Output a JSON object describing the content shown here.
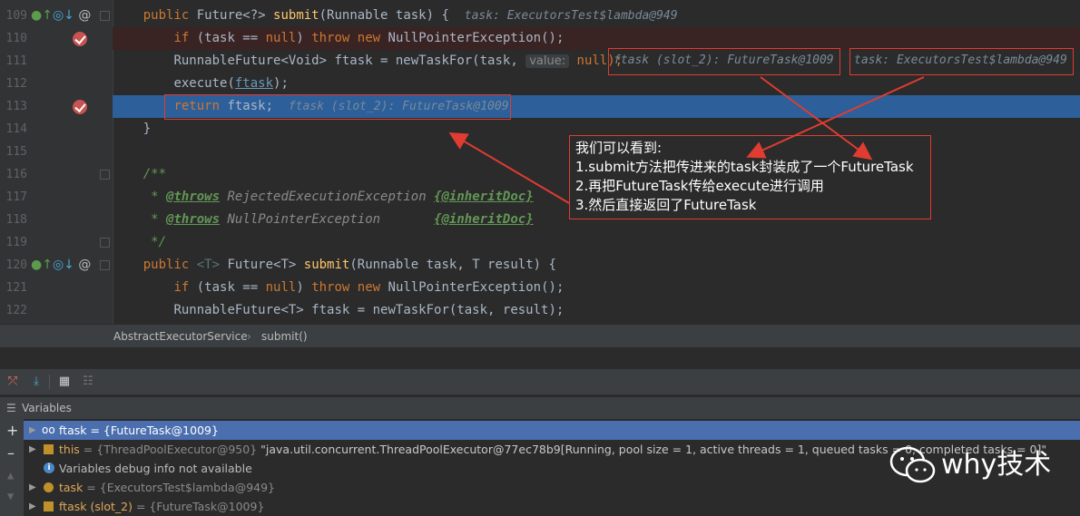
{
  "editor": {
    "lines": [
      {
        "num": "109"
      },
      {
        "num": "110"
      },
      {
        "num": "111"
      },
      {
        "num": "112"
      },
      {
        "num": "113"
      },
      {
        "num": "114"
      },
      {
        "num": "115"
      },
      {
        "num": "116"
      },
      {
        "num": "117"
      },
      {
        "num": "118"
      },
      {
        "num": "119"
      },
      {
        "num": "120"
      },
      {
        "num": "121"
      },
      {
        "num": "122"
      }
    ],
    "tokens": {
      "public": "public",
      "future_gen": "Future<?>",
      "submit": "submit",
      "runnable_task": "(Runnable task) {",
      "hint_task": "task: ExecutorsTest$lambda@949",
      "if": "if",
      "task_null": "(task == ",
      "null": "null",
      "close_paren": ")",
      "throw": "throw",
      "new": "new",
      "npe": "NullPointerException();",
      "runnable_future": "RunnableFuture<Void>",
      "ftask_assign": "ftask = newTaskFor(task,",
      "value_label": "value:",
      "null_close": "null);",
      "hint_ftask_slot": "ftask (slot_2): FutureTask@1009",
      "hint_task_lambda": "task: ExecutorsTest$lambda@949",
      "execute_open": "execute(",
      "ftask": "ftask",
      "close_semi": ");",
      "return": "return",
      "ftask_semi": "ftask;",
      "hint_ftask_slot2": "ftask (slot_2): FutureTask@1009",
      "close_brace": "}",
      "javadoc_open": "/**",
      "star": "*",
      "throws": "@throws",
      "rejected": "RejectedExecutionException",
      "inherit": "{@inheritDoc}",
      "npe_doc": "NullPointerException",
      "javadoc_close": "*/",
      "t_gen": "<T>",
      "future_t": "Future<T>",
      "runnable_task_result": "(Runnable task, T result) {",
      "runnable_future_t": "RunnableFuture<T>",
      "ftask_assign_result": "ftask = newTaskFor(task, result);"
    }
  },
  "note": {
    "lines": [
      "我们可以看到:",
      "1.submit方法把传进来的task封装成了一个FutureTask",
      "2.再把FutureTask传给execute进行调用",
      "3.然后直接返回了FutureTask"
    ]
  },
  "breadcrumb": {
    "class_name": "AbstractExecutorService",
    "method_name": "submit()"
  },
  "variables_panel": {
    "title": "Variables",
    "rows": [
      {
        "name": "ftask",
        "value": "= {FutureTask@1009}"
      },
      {
        "name": "this",
        "value": "= {ThreadPoolExecutor@950}",
        "extra": "\"java.util.concurrent.ThreadPoolExecutor@77ec78b9[Running, pool size = 1, active threads = 1, queued tasks = 0, completed tasks = 0]\""
      },
      {
        "name": "Variables debug info not available"
      },
      {
        "name": "task",
        "value": "= {ExecutorsTest$lambda@949}"
      },
      {
        "name": "ftask (slot_2)",
        "value": "= {FutureTask@1009}"
      }
    ]
  },
  "watermark": {
    "text": "why技术"
  },
  "colors": {
    "accent_red": "#e03c31",
    "selection": "#2d5f9a",
    "panel": "#3c3f41"
  }
}
